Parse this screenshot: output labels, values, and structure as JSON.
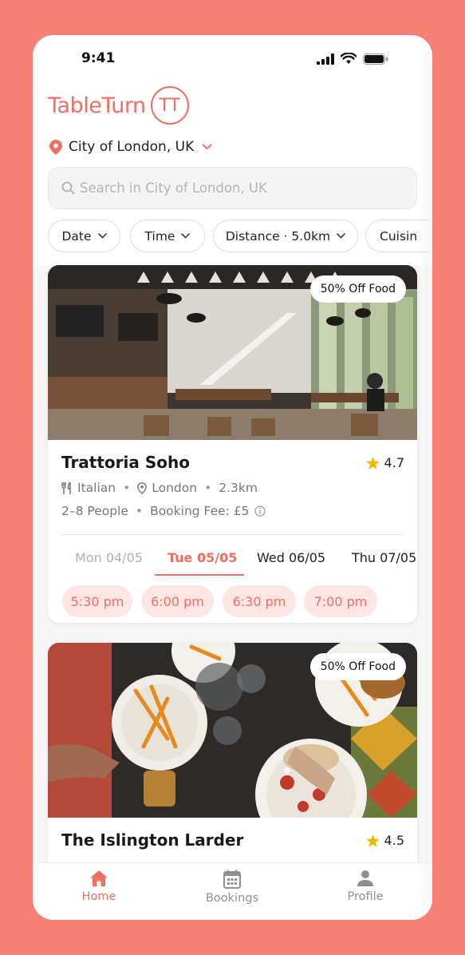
{
  "status_bar": {
    "time": "9:41"
  },
  "header": {
    "brand_name": "TableTurn",
    "logo_letters": "TT"
  },
  "location": {
    "label": "City of London, UK",
    "icon": "map-pin-icon"
  },
  "search": {
    "placeholder": "Search in City of London, UK",
    "icon": "search-icon"
  },
  "filters": [
    {
      "label": "Date"
    },
    {
      "label": "Time"
    },
    {
      "label": "Distance · 5.0km"
    },
    {
      "label": "Cuisin"
    }
  ],
  "restaurants": [
    {
      "name": "Trattoria Soho",
      "badge": "50% Off Food",
      "rating": "4.7",
      "cuisine": "Italian",
      "area": "London",
      "distance": "2.3km",
      "party": "2–8 People",
      "fee": "Booking Fee: £5",
      "dates": [
        {
          "label": "Mon 04/05",
          "state": "past"
        },
        {
          "label": "Tue 05/05",
          "state": "active"
        },
        {
          "label": "Wed 06/05",
          "state": "normal"
        },
        {
          "label": "Thu 07/05",
          "state": "normal"
        }
      ],
      "slots": [
        "5:30 pm",
        "6:00 pm",
        "6:30 pm",
        "7:00 pm"
      ]
    },
    {
      "name": "The Islington Larder",
      "badge": "50% Off Food",
      "rating": "4.5"
    }
  ],
  "tabbar": [
    {
      "label": "Home",
      "icon": "home-icon",
      "active": true
    },
    {
      "label": "Bookings",
      "icon": "calendar-icon",
      "active": false
    },
    {
      "label": "Profile",
      "icon": "person-icon",
      "active": false
    }
  ],
  "colors": {
    "accent": "#ef6f63",
    "frame": "#f67f76",
    "slot_bg": "#fde6e4",
    "star": "#f5b400"
  }
}
